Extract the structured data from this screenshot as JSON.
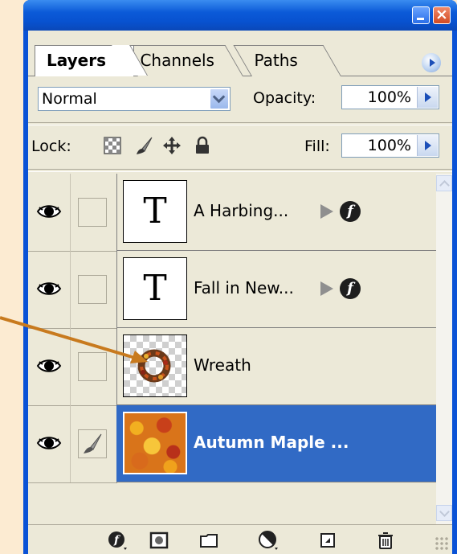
{
  "tabs": [
    {
      "label": "Layers",
      "active": true
    },
    {
      "label": "Channels",
      "active": false
    },
    {
      "label": "Paths",
      "active": false
    }
  ],
  "blend_mode": "Normal",
  "opacity": {
    "label": "Opacity:",
    "value": "100%"
  },
  "lock": {
    "label": "Lock:",
    "icons": [
      "lock-transparent-icon",
      "lock-image-icon",
      "lock-position-icon",
      "lock-all-icon"
    ]
  },
  "fill": {
    "label": "Fill:",
    "value": "100%"
  },
  "layers": [
    {
      "name": "A Harbing...",
      "type": "text",
      "thumb_glyph": "T",
      "has_effects": true,
      "visible": true,
      "selected": false
    },
    {
      "name": "Fall in New...",
      "type": "text",
      "thumb_glyph": "T",
      "has_effects": true,
      "visible": true,
      "selected": false
    },
    {
      "name": "Wreath",
      "type": "image",
      "has_effects": false,
      "visible": true,
      "selected": false
    },
    {
      "name": "Autumn Maple ...",
      "type": "image",
      "has_effects": false,
      "visible": true,
      "selected": true
    }
  ],
  "effects_glyph": "f",
  "bottom_toolbar": [
    "add-style-icon",
    "add-mask-icon",
    "new-group-icon",
    "adjustment-layer-icon",
    "new-layer-icon",
    "delete-layer-icon"
  ],
  "colors": {
    "accent": "#316ac5",
    "titlebar": "#0a52d6",
    "panel_bg": "#ece9d8",
    "annotation": "#c87a1e"
  }
}
